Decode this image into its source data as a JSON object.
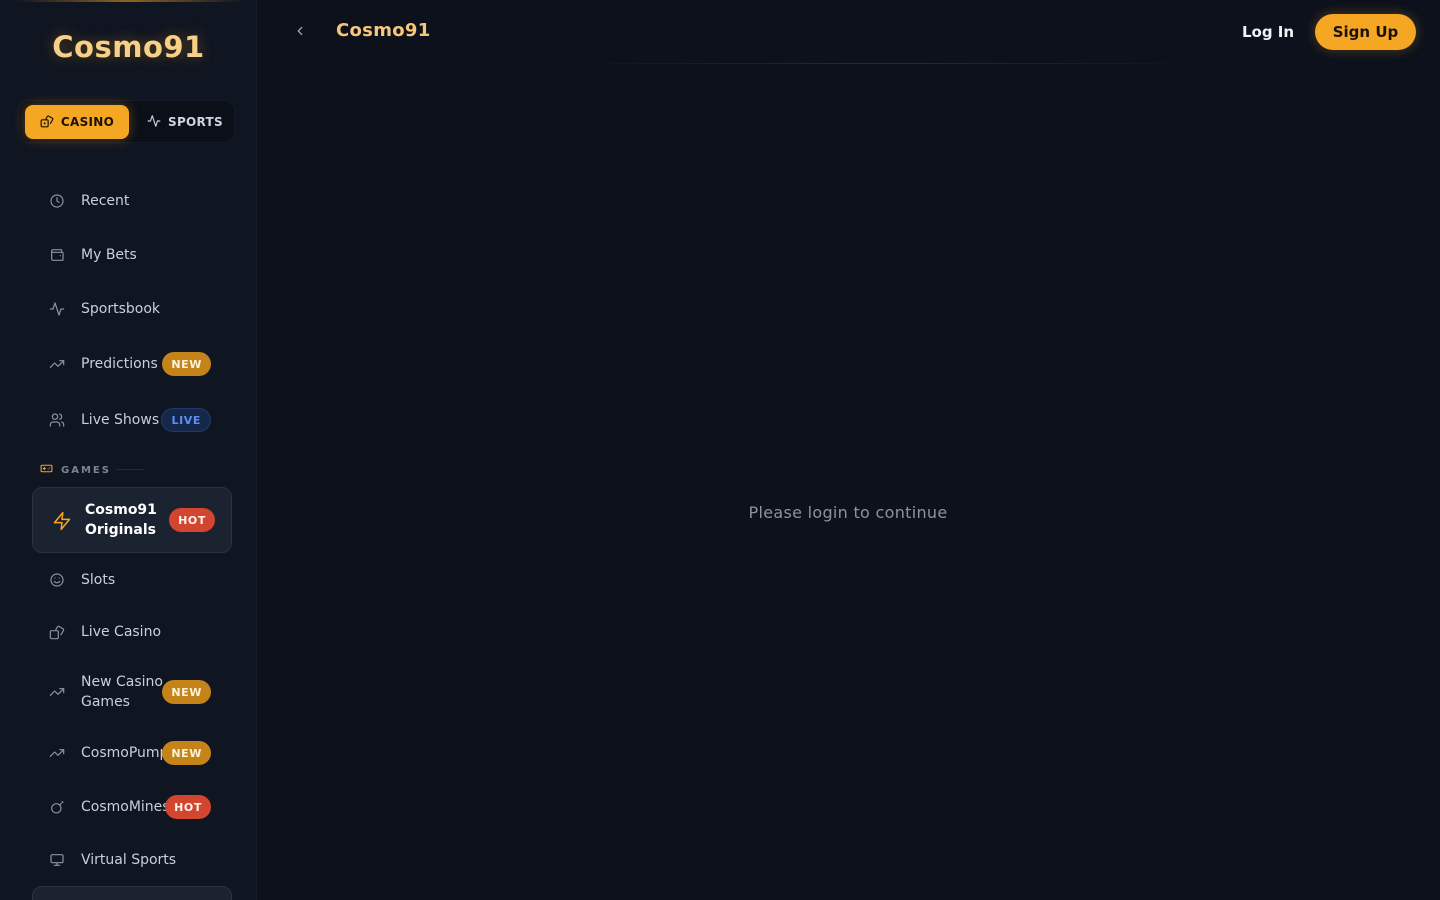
{
  "brand": {
    "name": "Cosmo91"
  },
  "mode_toggle": {
    "casino_label": "CASINO",
    "sports_label": "SPORTS",
    "active": "CASINO"
  },
  "sidebar": {
    "items": [
      {
        "label": "Recent",
        "icon": "clock-icon"
      },
      {
        "label": "My Bets",
        "icon": "wallet-icon"
      },
      {
        "label": "Sportsbook",
        "icon": "activity-icon"
      },
      {
        "label": "Predictions",
        "icon": "trending-up-icon",
        "badge": "NEW"
      },
      {
        "label": "Live Shows",
        "icon": "users-icon",
        "badge": "LIVE"
      }
    ],
    "games_section_label": "GAMES",
    "featured": {
      "label": "Cosmo91 Originals",
      "icon": "lightning-icon",
      "badge": "HOT"
    },
    "games": [
      {
        "label": "Slots",
        "icon": "smile-icon"
      },
      {
        "label": "Live Casino",
        "icon": "dice-icon"
      },
      {
        "label": "New Casino Games",
        "icon": "trending-up-icon",
        "badge": "NEW"
      },
      {
        "label": "CosmoPump",
        "icon": "trending-up-icon",
        "badge": "NEW"
      },
      {
        "label": "CosmoMines",
        "icon": "bomb-icon",
        "badge": "HOT"
      },
      {
        "label": "Virtual Sports",
        "icon": "monitor-icon"
      }
    ]
  },
  "header": {
    "title": "Cosmo91",
    "login_label": "Log In",
    "signup_label": "Sign Up"
  },
  "main": {
    "message": "Please login to continue"
  },
  "colors": {
    "accent": "#f5a623",
    "background": "#0c111c",
    "sidebar": "#0f1521",
    "hot": "#d2452e",
    "live": "#5b8ff3"
  }
}
